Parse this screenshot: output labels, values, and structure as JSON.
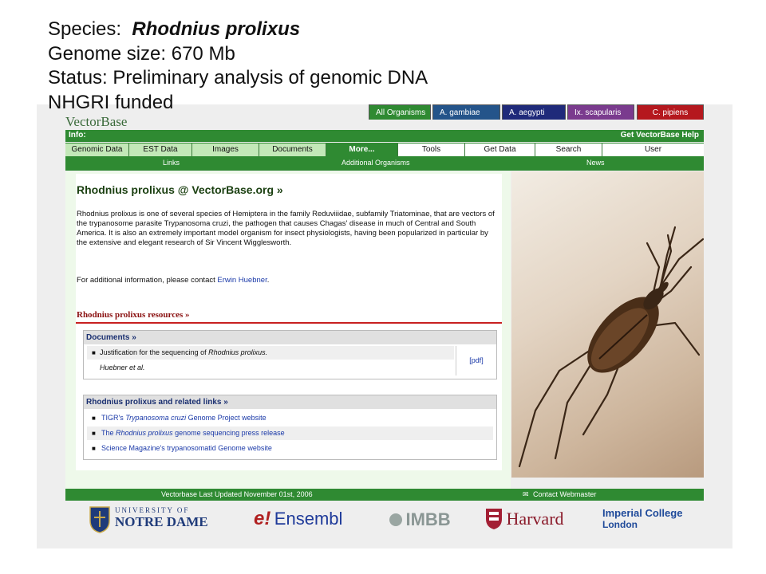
{
  "slide": {
    "line1_prefix": "Species:",
    "species": "Rhodnius prolixus",
    "line2": "Genome size:  670 Mb",
    "line3": "Status:  Preliminary analysis of genomic DNA",
    "line4": "NHGRI funded"
  },
  "site": {
    "logo": "VectorBase",
    "tabs": [
      "All Organisms",
      "A. gambiae",
      "A. aegypti",
      "Ix. scapularis",
      "C. pipiens"
    ],
    "info_label": "Info:",
    "help": "Get VectorBase Help",
    "menu": [
      "Genomic Data",
      "EST Data",
      "Images",
      "Documents",
      "More...",
      "Tools",
      "Get Data",
      "Search",
      "User"
    ],
    "links_bar": {
      "links": "Links",
      "additional": "Additional Organisms",
      "news": "News"
    },
    "heading": "Rhodnius prolixus @ VectorBase.org »",
    "description": "Rhodnius prolixus is one of several species of Hemiptera in the family Reduviiidae, subfamily Triatominae, that are vectors of the trypanosome parasite Trypanosoma cruzi, the pathogen that causes Chagas' disease in much of Central and South America. It is also an extremely important model organism for insect physiologists, having been popularized in particular by the extensive and elegant research of Sir Vincent Wigglesworth.",
    "contact_prefix": "For additional information, please contact",
    "contact_name": "Erwin Huebner",
    "contact_suffix": ".",
    "resources_title": "Rhodnius prolixus resources »",
    "documents": {
      "title": "Documents »",
      "item_prefix": "Justification for the sequencing of",
      "item_italic": "Rhodnius prolixus.",
      "authors": "Huebner et al.",
      "pdf": "[pdf]"
    },
    "related": {
      "title": "Rhodnius prolixus and related links »",
      "link1_a": "TIGR's",
      "link1_i": "Trypanosoma cruzi",
      "link1_b": "Genome Project website",
      "link2_a": "The",
      "link2_i": "Rhodnius prolixus",
      "link2_b": "genome sequencing press release",
      "link3": "Science Magazine's trypanosomatid Genome website"
    },
    "footer_updated": "Vectorbase Last Updated November 01st, 2006",
    "footer_contact": "Contact Webmaster",
    "logos": {
      "notre_dame_1": "UNIVERSITY OF",
      "notre_dame_2": "NOTRE DAME",
      "ensembl": "Ensembl",
      "ensembl_e": "e!",
      "imbb": "IMBB",
      "harvard": "Harvard",
      "imperial_1": "Imperial College",
      "imperial_2": "London"
    }
  },
  "colors": {
    "green": "#2f8a32",
    "light_green": "#c3e8b8",
    "link_blue": "#1a39a8",
    "resource_red": "#8a1010"
  }
}
